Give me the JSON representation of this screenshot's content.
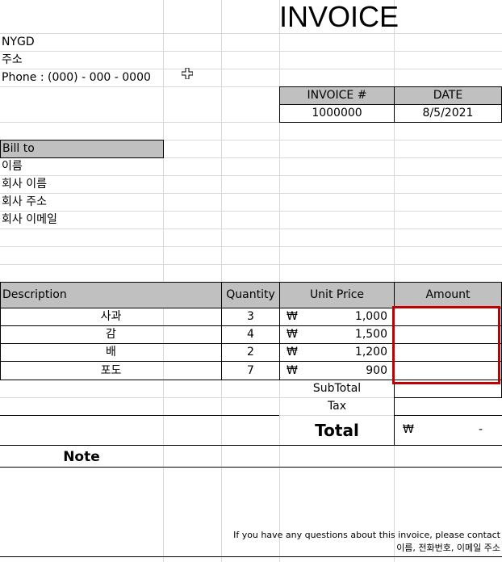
{
  "title": "INVOICE",
  "company": {
    "name": "NYGD",
    "address": "주소",
    "phone": "Phone : (000) - 000 - 0000"
  },
  "invoice_meta": {
    "number_label": "INVOICE #",
    "date_label": "DATE",
    "number": "1000000",
    "date": "8/5/2021"
  },
  "bill_to": {
    "label": "Bill to",
    "name": "이름",
    "company": "회사 이름",
    "address": "회사 주소",
    "email": "회사 이메일"
  },
  "table": {
    "headers": {
      "description": "Description",
      "quantity": "Quantity",
      "unit_price": "Unit Price",
      "amount": "Amount"
    },
    "currency": "₩",
    "rows": [
      {
        "description": "사과",
        "quantity": "3",
        "unit_price": "1,000"
      },
      {
        "description": "감",
        "quantity": "4",
        "unit_price": "1,500"
      },
      {
        "description": "배",
        "quantity": "2",
        "unit_price": "1,200"
      },
      {
        "description": "포도",
        "quantity": "7",
        "unit_price": "900"
      }
    ]
  },
  "totals": {
    "subtotal_label": "SubTotal",
    "tax_label": "Tax",
    "total_label": "Total",
    "total_currency": "₩",
    "total_value": "-"
  },
  "note_label": "Note",
  "footer": {
    "line1": "If you have any questions about this invoice, please contact",
    "line2": "이름, 전화번호, 이메일 주소"
  },
  "colors": {
    "header_fill": "#c0c0c0",
    "selection_border": "#c00000",
    "gridline": "#d9d9d9"
  }
}
